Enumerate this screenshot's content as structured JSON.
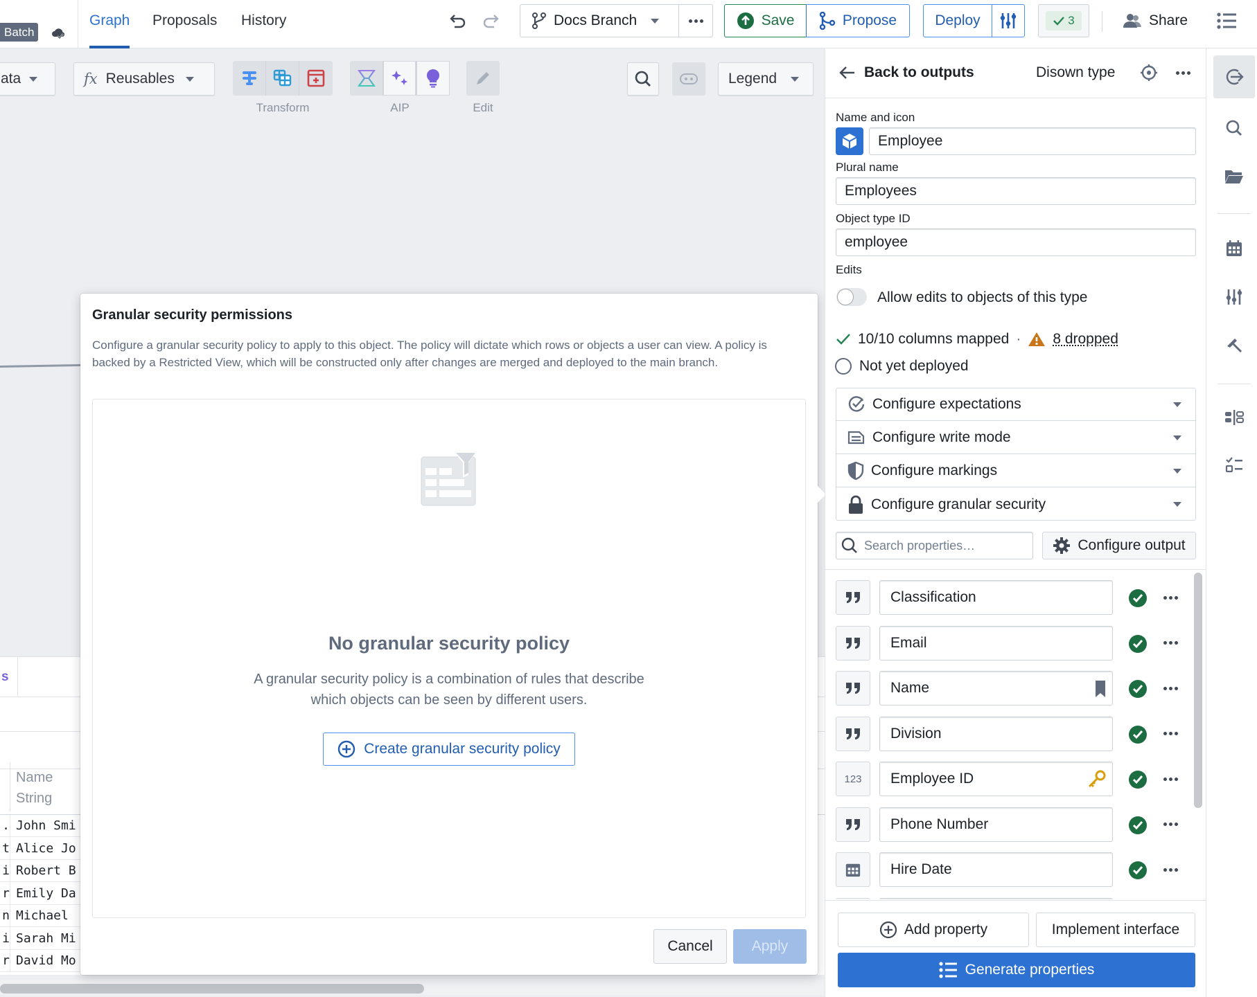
{
  "topbar": {
    "mode_tag": "Batch",
    "tabs": [
      {
        "label": "Graph",
        "active": true
      },
      {
        "label": "Proposals",
        "active": false
      },
      {
        "label": "History",
        "active": false
      }
    ],
    "branch_label": "Docs Branch",
    "save_label": "Save",
    "propose_label": "Propose",
    "deploy_label": "Deploy",
    "checks_count": "3",
    "share_label": "Share"
  },
  "toolbar": {
    "data_dropdown_label": "ata",
    "reusables_label": "Reusables",
    "reusables_prefix": "fx",
    "groups": [
      {
        "label": "Transform",
        "icons": [
          "filter-rows-icon",
          "join-table-icon",
          "add-column-icon"
        ]
      },
      {
        "label": "AIP",
        "icons": [
          "llm-transform-icon",
          "sparkle-icon",
          "lightbulb-icon"
        ]
      },
      {
        "label": "Edit",
        "icons": [
          "pencil-icon"
        ]
      }
    ],
    "legend_label": "Legend"
  },
  "canvas": {
    "table_tab_fragment": "s",
    "column_header": {
      "name": "Name",
      "type": "String"
    },
    "rows": [
      {
        "prev": ".",
        "name": "John Smi"
      },
      {
        "prev": "t",
        "name": "Alice Jo"
      },
      {
        "prev": "i",
        "name": "Robert B"
      },
      {
        "prev": "r",
        "name": "Emily Da"
      },
      {
        "prev": "n",
        "name": "Michael "
      },
      {
        "prev": "i",
        "name": "Sarah Mi"
      },
      {
        "prev": "r",
        "name": "David Mo"
      }
    ]
  },
  "modal": {
    "title": "Granular security permissions",
    "description": "Configure a granular security policy to apply to this object. The policy will dictate which rows or objects a user can view. A policy is backed by a Restricted View, which will be constructed only after changes are merged and deployed to the main branch.",
    "empty_title": "No granular security policy",
    "empty_description_line1": "A granular security policy is a combination of rules that describe",
    "empty_description_line2": "which objects can be seen by different users.",
    "create_label": "Create granular security policy",
    "cancel_label": "Cancel",
    "apply_label": "Apply"
  },
  "panel": {
    "back_label": "Back to outputs",
    "disown_label": "Disown type",
    "name_label": "Name and icon",
    "name_value": "Employee",
    "plural_label": "Plural name",
    "plural_value": "Employees",
    "id_label": "Object type ID",
    "id_value": "employee",
    "edits_label": "Edits",
    "edits_toggle_label": "Allow edits to objects of this type",
    "edits_enabled": false,
    "columns_status": "10/10 columns mapped",
    "dropped_label": "8 dropped",
    "deploy_status": "Not yet deployed",
    "config_sections": [
      {
        "label": "Configure expectations",
        "icon": "expectations-icon"
      },
      {
        "label": "Configure write mode",
        "icon": "write-mode-icon"
      },
      {
        "label": "Configure markings",
        "icon": "shield-icon"
      },
      {
        "label": "Configure granular security",
        "icon": "lock-icon"
      }
    ],
    "search_placeholder": "Search properties…",
    "configure_output_label": "Configure output",
    "properties": [
      {
        "type": "string",
        "name": "Classification",
        "badge": ""
      },
      {
        "type": "string",
        "name": "Email",
        "badge": ""
      },
      {
        "type": "string",
        "name": "Name",
        "badge": "title-bookmark"
      },
      {
        "type": "string",
        "name": "Division",
        "badge": ""
      },
      {
        "type": "integer",
        "type_label": "123",
        "name": "Employee ID",
        "badge": "primary-key"
      },
      {
        "type": "string",
        "name": "Phone Number",
        "badge": ""
      },
      {
        "type": "date",
        "name": "Hire Date",
        "badge": ""
      }
    ],
    "add_property_label": "Add property",
    "implement_interface_label": "Implement interface",
    "generate_properties_label": "Generate properties"
  },
  "rail": {
    "items": [
      "output-icon",
      "search-icon",
      "folder-icon",
      "calendar-icon",
      "sliders-icon",
      "hammer-icon",
      "columns-icon",
      "checklist-icon"
    ]
  },
  "colors": {
    "accent": "#2d72d2",
    "success": "#238551",
    "warning": "#c87619",
    "primary_key": "#d99e0b"
  }
}
